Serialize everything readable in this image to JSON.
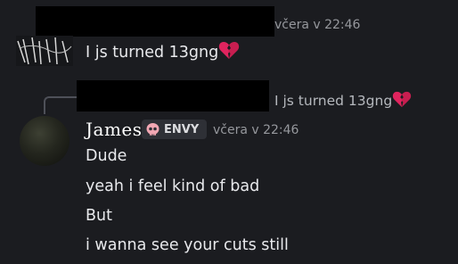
{
  "top_message": {
    "timestamp": "včera v 22:46",
    "text": "I js turned 13gng",
    "emoji": "broken-heart-icon"
  },
  "reply_preview": {
    "text": "I js turned 13gng",
    "emoji": "broken-heart-icon"
  },
  "message": {
    "username": "James",
    "tag": "ENVY",
    "tag_icon": "skull-icon",
    "timestamp": "včera v 22:46",
    "lines": [
      "Dude",
      "yeah i feel kind of bad",
      "But",
      "i wanna see your cuts still"
    ]
  },
  "colors": {
    "background": "#1b1c20",
    "heart": "#e0245e"
  }
}
